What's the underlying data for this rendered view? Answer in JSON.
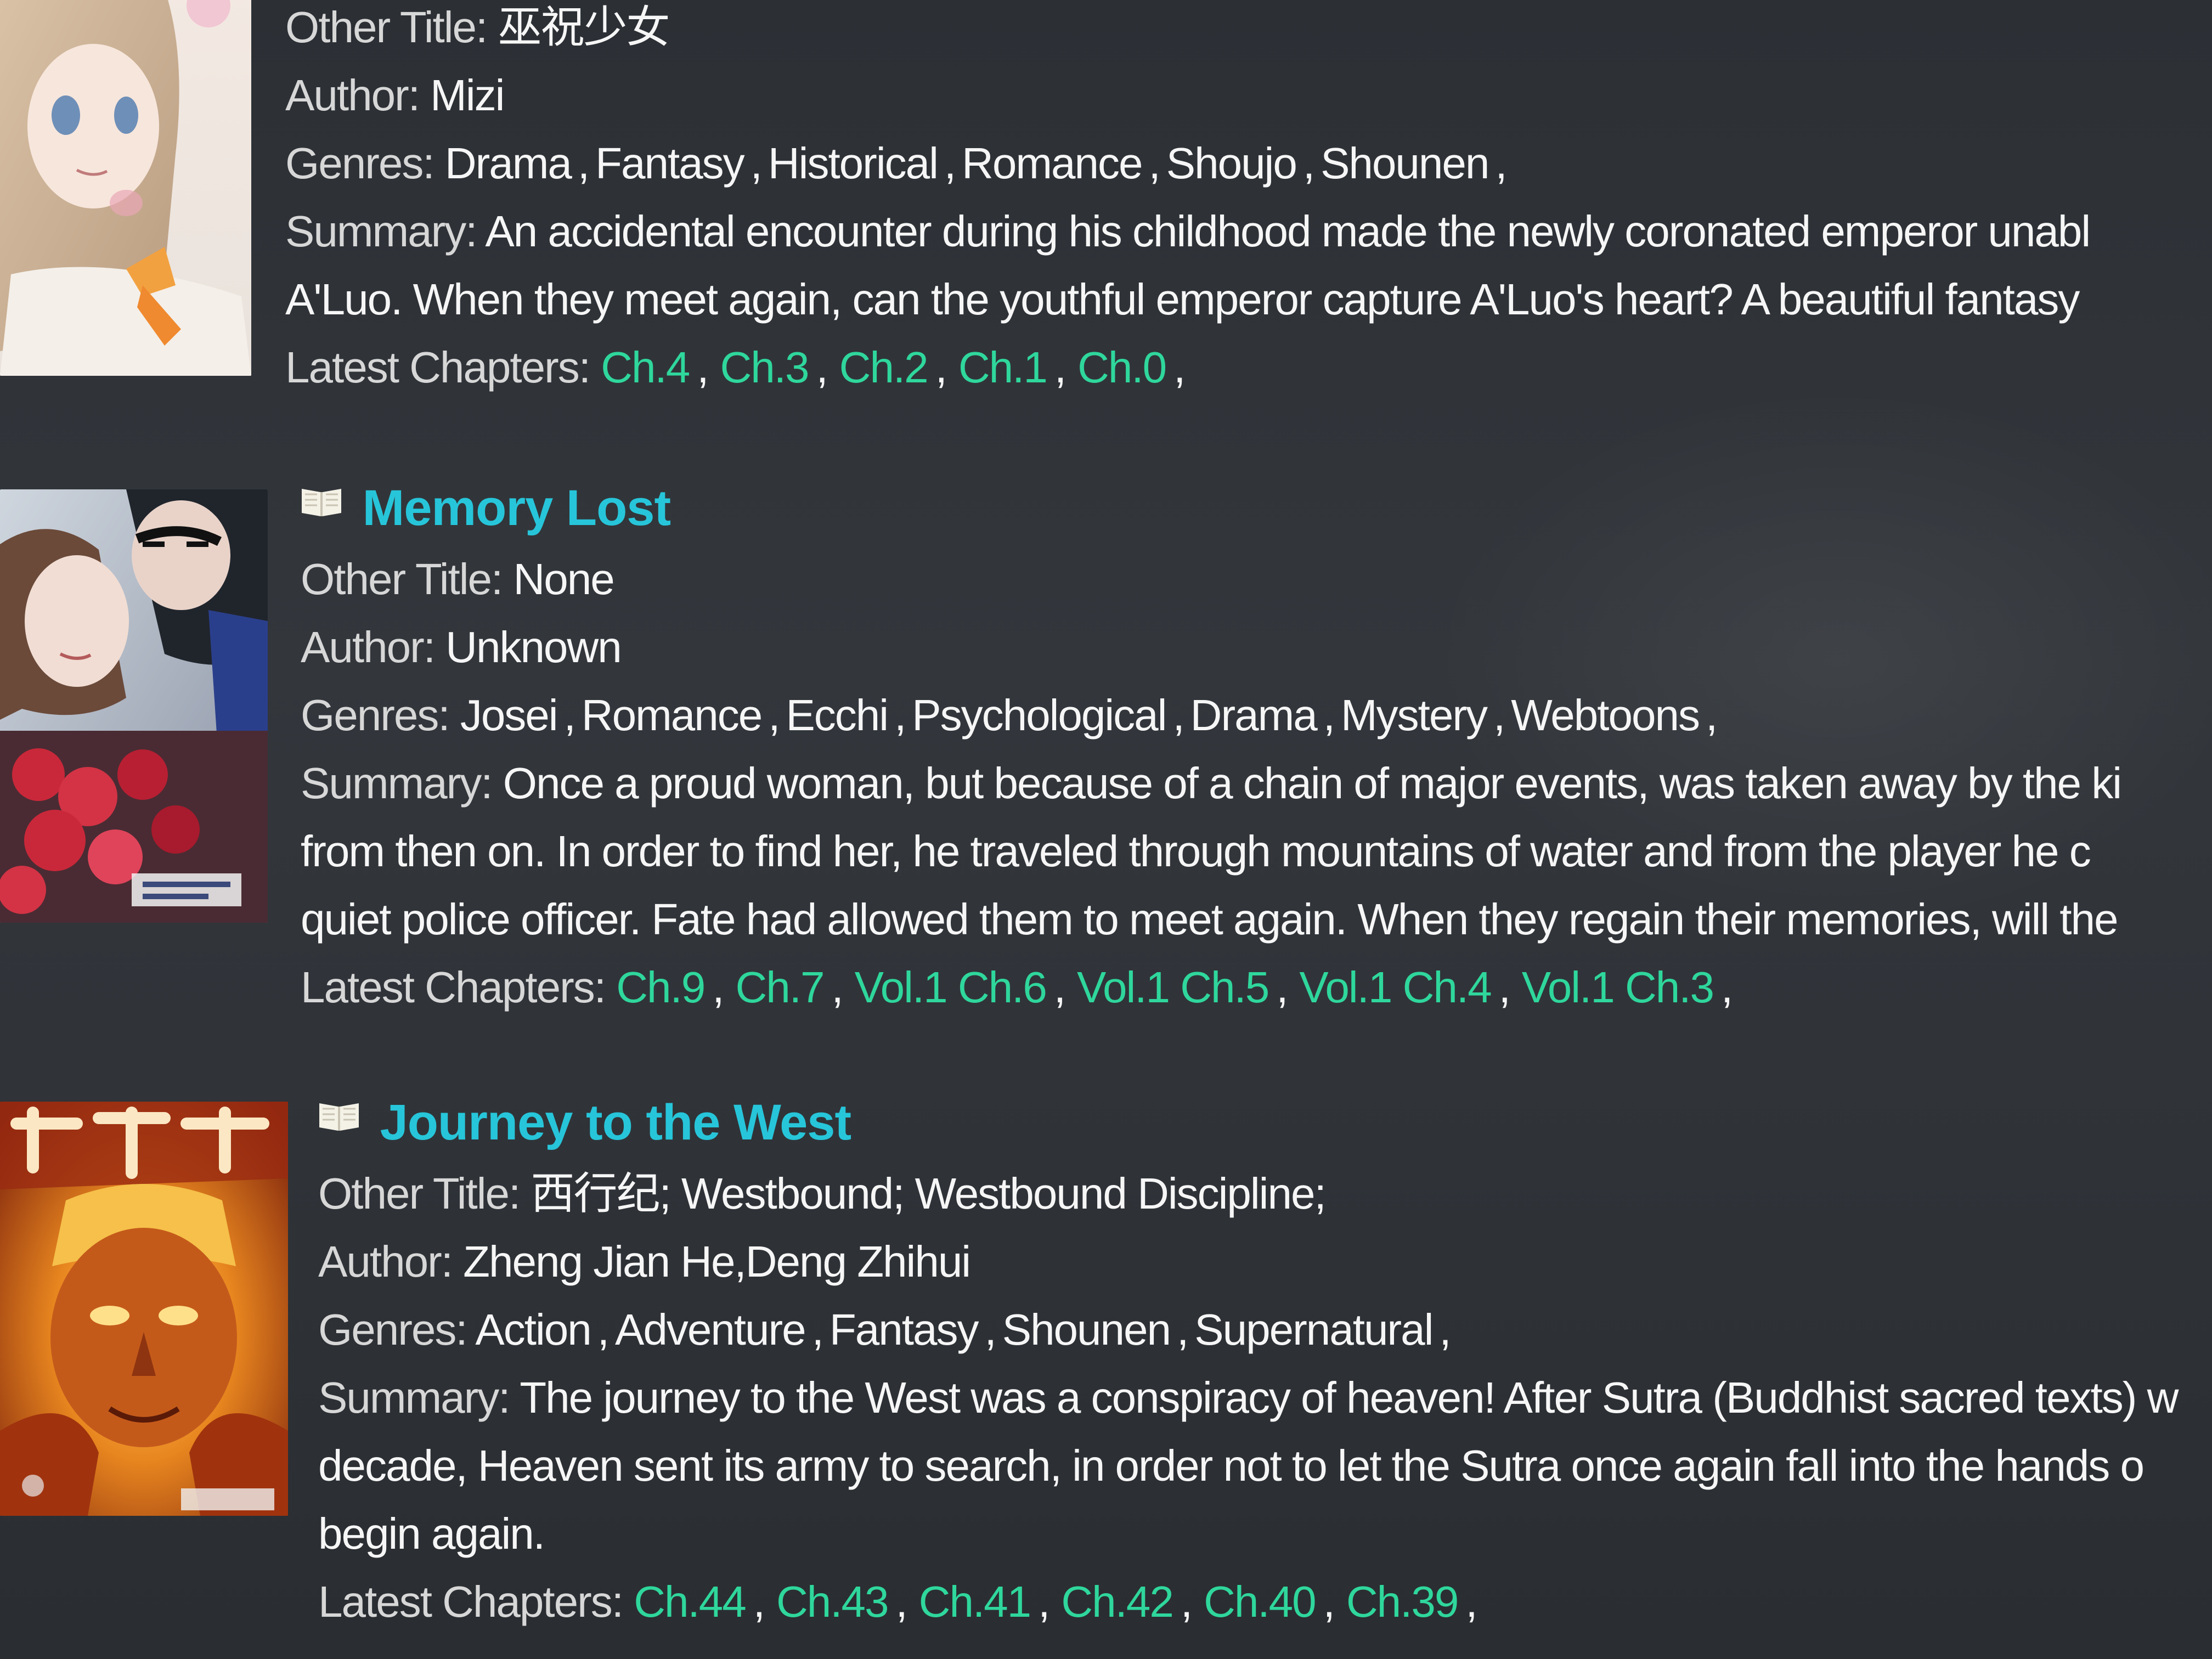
{
  "entries": [
    {
      "title": "",
      "other_title_label": "Other Title:",
      "other_title": "巫祝少女",
      "author_label": "Author:",
      "author": "Mizi",
      "genres_label": "Genres:",
      "genres": [
        "Drama",
        "Fantasy",
        "Historical",
        "Romance",
        "Shoujo",
        "Shounen"
      ],
      "summary_label": "Summary:",
      "summary_lines": [
        "An accidental encounter during his childhood made the newly coronated emperor unabl",
        "A'Luo. When they meet again, can the youthful emperor capture A'Luo's heart? A beautiful fantasy"
      ],
      "chapters_label": "Latest Chapters:",
      "chapters": [
        "Ch.4",
        "Ch.3",
        "Ch.2",
        "Ch.1",
        "Ch.0"
      ]
    },
    {
      "title": "Memory Lost",
      "other_title_label": "Other Title:",
      "other_title": "None",
      "author_label": "Author:",
      "author": "Unknown",
      "genres_label": "Genres:",
      "genres": [
        "Josei",
        "Romance",
        "Ecchi",
        "Psychological",
        "Drama",
        "Mystery",
        "Webtoons"
      ],
      "summary_label": "Summary:",
      "summary_lines": [
        "Once a proud woman, but because of a chain of major events, was taken away by the ki",
        "from then on. In order to find her, he traveled through mountains of water and from the player he c",
        "quiet police officer. Fate had allowed them to meet again. When they regain their memories, will the"
      ],
      "chapters_label": "Latest Chapters:",
      "chapters": [
        "Ch.9",
        "Ch.7",
        "Vol.1 Ch.6",
        "Vol.1 Ch.5",
        "Vol.1 Ch.4",
        "Vol.1 Ch.3"
      ]
    },
    {
      "title": "Journey to the West",
      "other_title_label": "Other Title:",
      "other_title": "西行纪; Westbound; Westbound Discipline;",
      "author_label": "Author:",
      "author": "Zheng Jian He,Deng Zhihui",
      "genres_label": "Genres:",
      "genres": [
        "Action",
        "Adventure",
        "Fantasy",
        "Shounen",
        "Supernatural"
      ],
      "summary_label": "Summary:",
      "summary_lines": [
        "The journey to the West was a conspiracy of heaven! After Sutra (Buddhist sacred texts) w",
        "decade, Heaven sent its army to search, in order not to let the Sutra once again fall into the hands o",
        "begin again."
      ],
      "chapters_label": "Latest Chapters:",
      "chapters": [
        "Ch.44",
        "Ch.43",
        "Ch.41",
        "Ch.42",
        "Ch.40",
        "Ch.39"
      ]
    }
  ],
  "icons": {
    "title_icon": "book-icon"
  },
  "colors": {
    "background": "#2f3338",
    "title_link": "#27c5d9",
    "chapter_link": "#2fd79c",
    "label_text": "#d7d7d7",
    "value_text": "#f6f6f6"
  }
}
